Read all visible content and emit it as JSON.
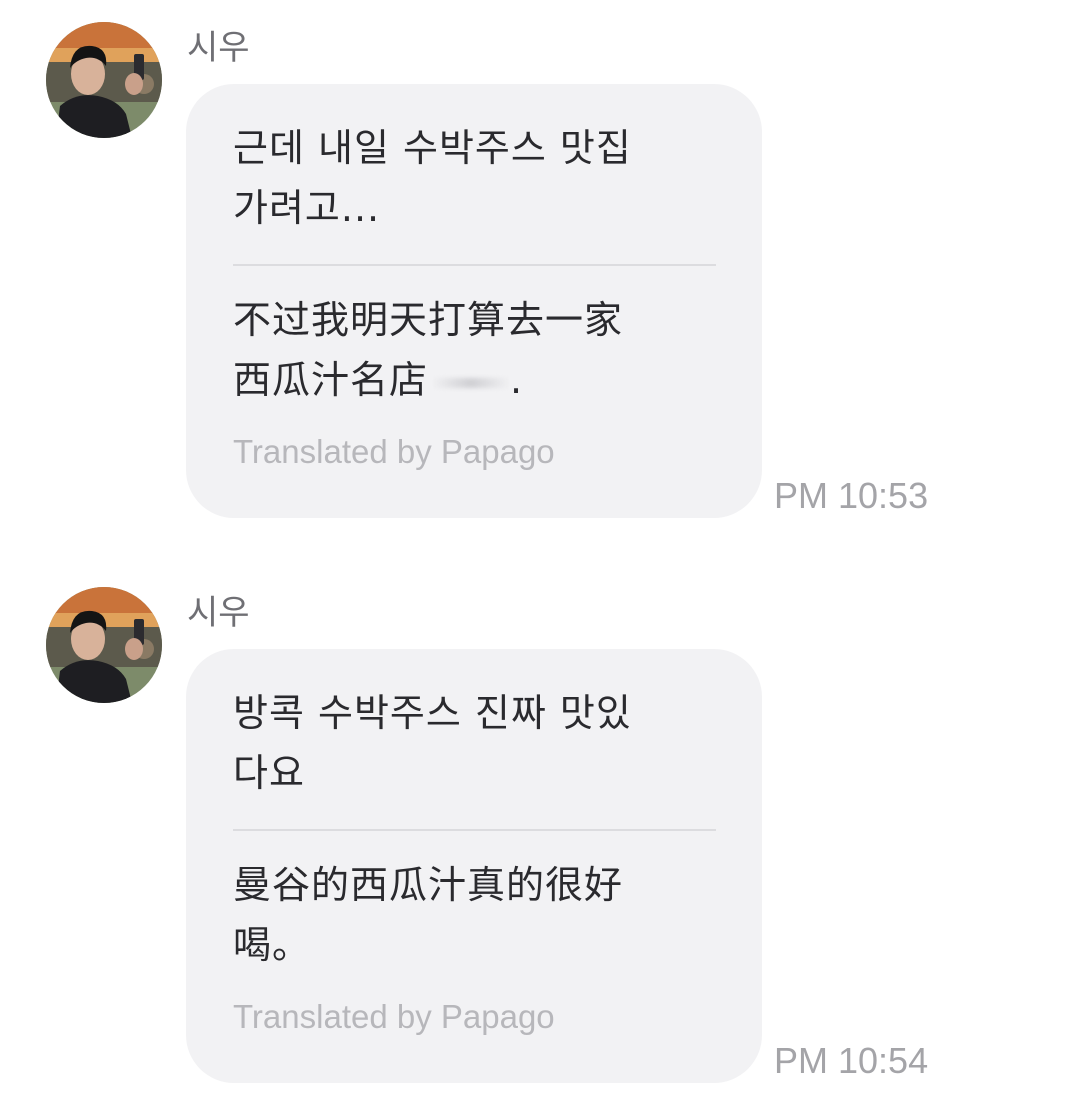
{
  "messages": [
    {
      "sender": "시우",
      "original": "근데 내일 수박주스 맛집\n가려고...",
      "translated_main": "不过我明天打算去一家\n西瓜汁名店",
      "translated_tail": ".",
      "attribution": "Translated by Papago",
      "time": "PM 10:53"
    },
    {
      "sender": "시우",
      "original": "방콕 수박주스 진짜 맛있\n다요",
      "translated_main": "曼谷的西瓜汁真的很好\n喝。",
      "translated_tail": "",
      "attribution": "Translated by Papago",
      "time": "PM 10:54"
    }
  ],
  "colors": {
    "bubble": "#f2f2f4",
    "text": "#2a2a2e",
    "meta": "#a4a4a8"
  }
}
